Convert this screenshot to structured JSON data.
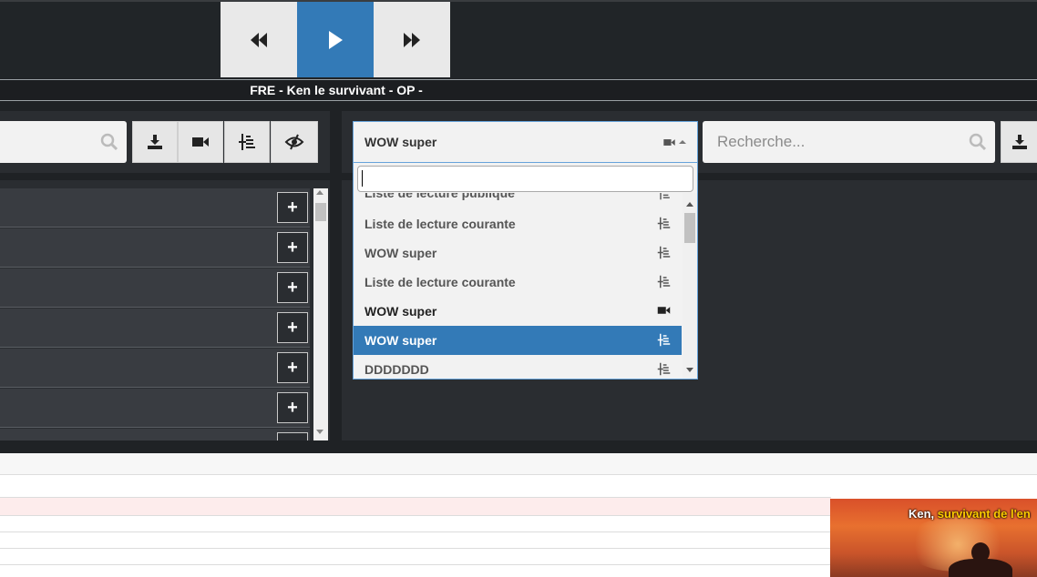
{
  "player": {
    "now_playing": "FRE - Ken le survivant - OP -",
    "controls": [
      "rewind",
      "play",
      "fast-forward"
    ]
  },
  "right_panel": {
    "selected_playlist": "WOW super",
    "search_placeholder": "Recherche...",
    "dropdown_search_value": "",
    "options": [
      {
        "label": "Liste de lecture publique",
        "icon": "playlist-icon"
      },
      {
        "label": "Liste de lecture courante",
        "icon": "playlist-icon"
      },
      {
        "label": "WOW super",
        "icon": "playlist-icon"
      },
      {
        "label": "Liste de lecture courante",
        "icon": "playlist-icon"
      },
      {
        "label": "WOW super",
        "icon": "video-icon"
      },
      {
        "label": "WOW super",
        "icon": "playlist-icon",
        "active": true
      },
      {
        "label": "DDDDDDD",
        "icon": "playlist-icon"
      }
    ]
  },
  "left_panel": {
    "toolbar": [
      "import-icon",
      "video-icon",
      "playlist-icon",
      "hidden-eye-icon"
    ],
    "row_add_label": "+"
  },
  "video": {
    "subtitle_white": "Ken,",
    "subtitle_yellow": " survivant de l'en"
  },
  "colors": {
    "accent": "#337ab7",
    "background": "#1f2225",
    "panel": "#2a2d31"
  }
}
